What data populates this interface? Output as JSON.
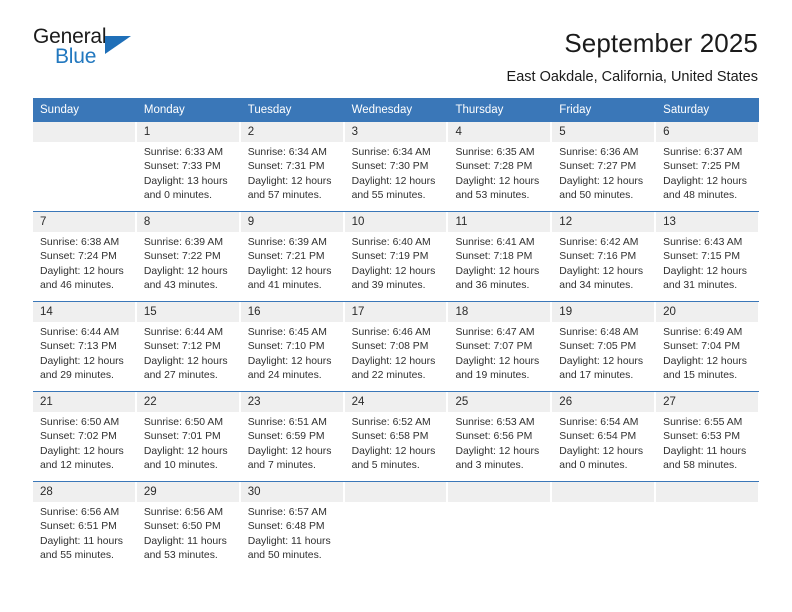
{
  "brand": {
    "name_top": "General",
    "name_bottom": "Blue",
    "accent_color": "#2278bf",
    "triangle_color": "#1f6fb8"
  },
  "header": {
    "title": "September 2025",
    "subtitle": "East Oakdale, California, United States"
  },
  "calendar": {
    "header_bg": "#3a77b8",
    "daynum_bg": "#efefef",
    "weekdays": [
      "Sunday",
      "Monday",
      "Tuesday",
      "Wednesday",
      "Thursday",
      "Friday",
      "Saturday"
    ],
    "weeks": [
      [
        {
          "day": "",
          "sunrise": "",
          "sunset": "",
          "daylight_1": "",
          "daylight_2": ""
        },
        {
          "day": "1",
          "sunrise": "Sunrise: 6:33 AM",
          "sunset": "Sunset: 7:33 PM",
          "daylight_1": "Daylight: 13 hours",
          "daylight_2": "and 0 minutes."
        },
        {
          "day": "2",
          "sunrise": "Sunrise: 6:34 AM",
          "sunset": "Sunset: 7:31 PM",
          "daylight_1": "Daylight: 12 hours",
          "daylight_2": "and 57 minutes."
        },
        {
          "day": "3",
          "sunrise": "Sunrise: 6:34 AM",
          "sunset": "Sunset: 7:30 PM",
          "daylight_1": "Daylight: 12 hours",
          "daylight_2": "and 55 minutes."
        },
        {
          "day": "4",
          "sunrise": "Sunrise: 6:35 AM",
          "sunset": "Sunset: 7:28 PM",
          "daylight_1": "Daylight: 12 hours",
          "daylight_2": "and 53 minutes."
        },
        {
          "day": "5",
          "sunrise": "Sunrise: 6:36 AM",
          "sunset": "Sunset: 7:27 PM",
          "daylight_1": "Daylight: 12 hours",
          "daylight_2": "and 50 minutes."
        },
        {
          "day": "6",
          "sunrise": "Sunrise: 6:37 AM",
          "sunset": "Sunset: 7:25 PM",
          "daylight_1": "Daylight: 12 hours",
          "daylight_2": "and 48 minutes."
        }
      ],
      [
        {
          "day": "7",
          "sunrise": "Sunrise: 6:38 AM",
          "sunset": "Sunset: 7:24 PM",
          "daylight_1": "Daylight: 12 hours",
          "daylight_2": "and 46 minutes."
        },
        {
          "day": "8",
          "sunrise": "Sunrise: 6:39 AM",
          "sunset": "Sunset: 7:22 PM",
          "daylight_1": "Daylight: 12 hours",
          "daylight_2": "and 43 minutes."
        },
        {
          "day": "9",
          "sunrise": "Sunrise: 6:39 AM",
          "sunset": "Sunset: 7:21 PM",
          "daylight_1": "Daylight: 12 hours",
          "daylight_2": "and 41 minutes."
        },
        {
          "day": "10",
          "sunrise": "Sunrise: 6:40 AM",
          "sunset": "Sunset: 7:19 PM",
          "daylight_1": "Daylight: 12 hours",
          "daylight_2": "and 39 minutes."
        },
        {
          "day": "11",
          "sunrise": "Sunrise: 6:41 AM",
          "sunset": "Sunset: 7:18 PM",
          "daylight_1": "Daylight: 12 hours",
          "daylight_2": "and 36 minutes."
        },
        {
          "day": "12",
          "sunrise": "Sunrise: 6:42 AM",
          "sunset": "Sunset: 7:16 PM",
          "daylight_1": "Daylight: 12 hours",
          "daylight_2": "and 34 minutes."
        },
        {
          "day": "13",
          "sunrise": "Sunrise: 6:43 AM",
          "sunset": "Sunset: 7:15 PM",
          "daylight_1": "Daylight: 12 hours",
          "daylight_2": "and 31 minutes."
        }
      ],
      [
        {
          "day": "14",
          "sunrise": "Sunrise: 6:44 AM",
          "sunset": "Sunset: 7:13 PM",
          "daylight_1": "Daylight: 12 hours",
          "daylight_2": "and 29 minutes."
        },
        {
          "day": "15",
          "sunrise": "Sunrise: 6:44 AM",
          "sunset": "Sunset: 7:12 PM",
          "daylight_1": "Daylight: 12 hours",
          "daylight_2": "and 27 minutes."
        },
        {
          "day": "16",
          "sunrise": "Sunrise: 6:45 AM",
          "sunset": "Sunset: 7:10 PM",
          "daylight_1": "Daylight: 12 hours",
          "daylight_2": "and 24 minutes."
        },
        {
          "day": "17",
          "sunrise": "Sunrise: 6:46 AM",
          "sunset": "Sunset: 7:08 PM",
          "daylight_1": "Daylight: 12 hours",
          "daylight_2": "and 22 minutes."
        },
        {
          "day": "18",
          "sunrise": "Sunrise: 6:47 AM",
          "sunset": "Sunset: 7:07 PM",
          "daylight_1": "Daylight: 12 hours",
          "daylight_2": "and 19 minutes."
        },
        {
          "day": "19",
          "sunrise": "Sunrise: 6:48 AM",
          "sunset": "Sunset: 7:05 PM",
          "daylight_1": "Daylight: 12 hours",
          "daylight_2": "and 17 minutes."
        },
        {
          "day": "20",
          "sunrise": "Sunrise: 6:49 AM",
          "sunset": "Sunset: 7:04 PM",
          "daylight_1": "Daylight: 12 hours",
          "daylight_2": "and 15 minutes."
        }
      ],
      [
        {
          "day": "21",
          "sunrise": "Sunrise: 6:50 AM",
          "sunset": "Sunset: 7:02 PM",
          "daylight_1": "Daylight: 12 hours",
          "daylight_2": "and 12 minutes."
        },
        {
          "day": "22",
          "sunrise": "Sunrise: 6:50 AM",
          "sunset": "Sunset: 7:01 PM",
          "daylight_1": "Daylight: 12 hours",
          "daylight_2": "and 10 minutes."
        },
        {
          "day": "23",
          "sunrise": "Sunrise: 6:51 AM",
          "sunset": "Sunset: 6:59 PM",
          "daylight_1": "Daylight: 12 hours",
          "daylight_2": "and 7 minutes."
        },
        {
          "day": "24",
          "sunrise": "Sunrise: 6:52 AM",
          "sunset": "Sunset: 6:58 PM",
          "daylight_1": "Daylight: 12 hours",
          "daylight_2": "and 5 minutes."
        },
        {
          "day": "25",
          "sunrise": "Sunrise: 6:53 AM",
          "sunset": "Sunset: 6:56 PM",
          "daylight_1": "Daylight: 12 hours",
          "daylight_2": "and 3 minutes."
        },
        {
          "day": "26",
          "sunrise": "Sunrise: 6:54 AM",
          "sunset": "Sunset: 6:54 PM",
          "daylight_1": "Daylight: 12 hours",
          "daylight_2": "and 0 minutes."
        },
        {
          "day": "27",
          "sunrise": "Sunrise: 6:55 AM",
          "sunset": "Sunset: 6:53 PM",
          "daylight_1": "Daylight: 11 hours",
          "daylight_2": "and 58 minutes."
        }
      ],
      [
        {
          "day": "28",
          "sunrise": "Sunrise: 6:56 AM",
          "sunset": "Sunset: 6:51 PM",
          "daylight_1": "Daylight: 11 hours",
          "daylight_2": "and 55 minutes."
        },
        {
          "day": "29",
          "sunrise": "Sunrise: 6:56 AM",
          "sunset": "Sunset: 6:50 PM",
          "daylight_1": "Daylight: 11 hours",
          "daylight_2": "and 53 minutes."
        },
        {
          "day": "30",
          "sunrise": "Sunrise: 6:57 AM",
          "sunset": "Sunset: 6:48 PM",
          "daylight_1": "Daylight: 11 hours",
          "daylight_2": "and 50 minutes."
        },
        {
          "day": "",
          "sunrise": "",
          "sunset": "",
          "daylight_1": "",
          "daylight_2": ""
        },
        {
          "day": "",
          "sunrise": "",
          "sunset": "",
          "daylight_1": "",
          "daylight_2": ""
        },
        {
          "day": "",
          "sunrise": "",
          "sunset": "",
          "daylight_1": "",
          "daylight_2": ""
        },
        {
          "day": "",
          "sunrise": "",
          "sunset": "",
          "daylight_1": "",
          "daylight_2": ""
        }
      ]
    ]
  }
}
